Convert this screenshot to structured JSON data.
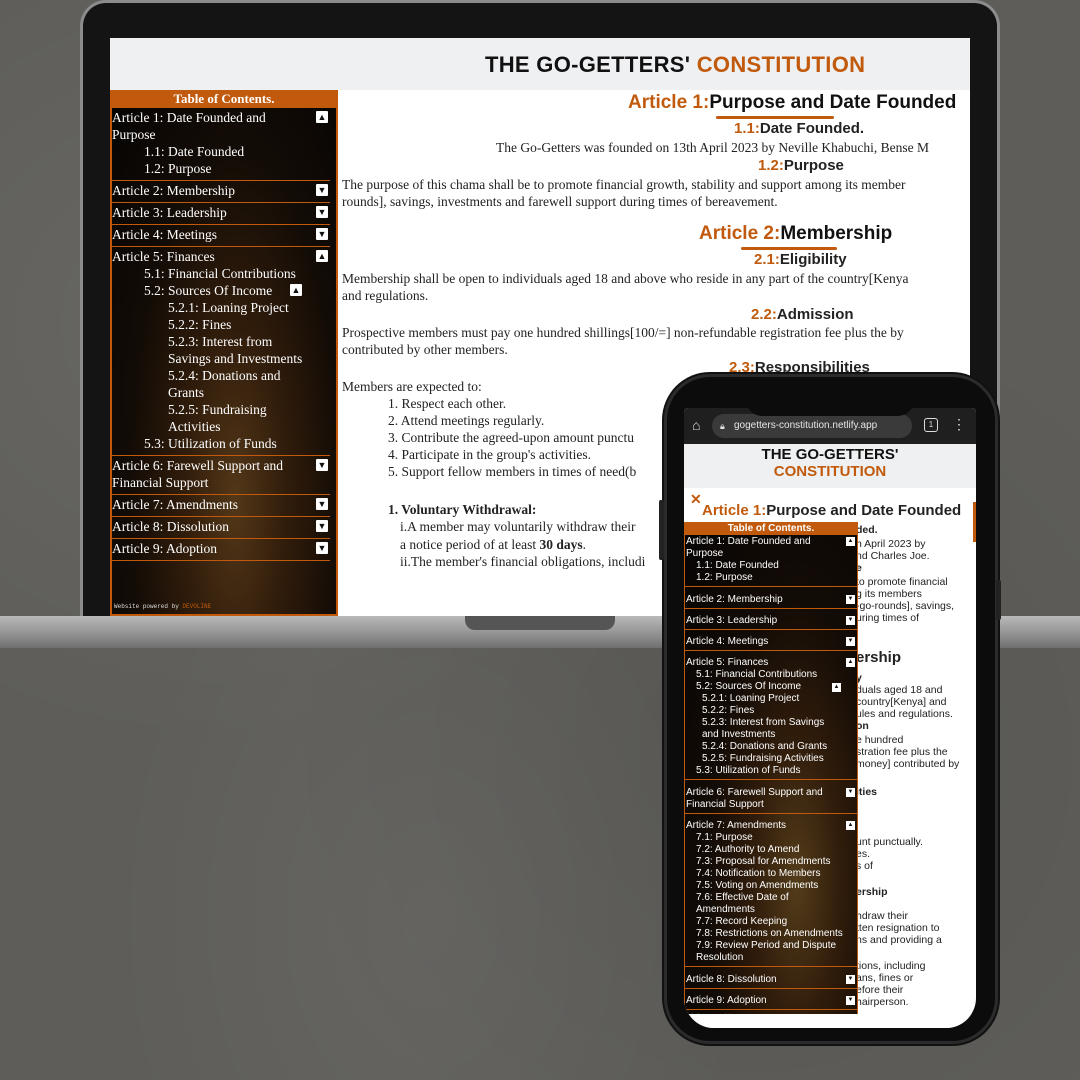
{
  "site": {
    "title_black": "THE GO-GETTERS'",
    "title_orange": "CONSTITUTION",
    "toc_heading": "Table of Contents.",
    "footer_prefix": "Website powered by",
    "footer_brand": "DEVOLINE"
  },
  "desktop": {
    "toc": [
      {
        "label": "Article 1: Date Founded and Purpose",
        "toggle": "▲",
        "subs": [
          {
            "label": "1.1: Date Founded"
          },
          {
            "label": "1.2: Purpose"
          }
        ]
      },
      {
        "label": "Article 2: Membership",
        "toggle": "▼"
      },
      {
        "label": "Article 3: Leadership",
        "toggle": "▼"
      },
      {
        "label": "Article 4: Meetings",
        "toggle": "▼"
      },
      {
        "label": "Article 5: Finances",
        "toggle": "▲"
      },
      {
        "label": "Article 6: Farewell Support and Financial Support",
        "toggle": "▼"
      },
      {
        "label": "Article 7: Amendments",
        "toggle": "▼"
      },
      {
        "label": "Article 8: Dissolution",
        "toggle": "▼"
      },
      {
        "label": "Article 9: Adoption",
        "toggle": "▼"
      }
    ],
    "finances_subs": {
      "s51": "5.1: Financial Contributions",
      "s52": "5.2: Sources Of Income",
      "s52_toggle": "▲",
      "s521": "5.2.1: Loaning Project",
      "s522": "5.2.2: Fines",
      "s523": "5.2.3: Interest from Savings and Investments",
      "s524": "5.2.4: Donations and Grants",
      "s525": "5.2.5: Fundraising Activities",
      "s53": "5.3: Utilization of Funds"
    },
    "content": {
      "a1_num": "Article 1:",
      "a1_title": "Purpose and Date Founded",
      "s11_num": "1.1:",
      "s11_title": "Date Founded.",
      "s11_text": "The Go-Getters was founded on 13th April 2023 by Neville Khabuchi, Bense M",
      "s12_num": "1.2:",
      "s12_title": "Purpose",
      "s12_text1": "The purpose of this chama shall be to promote financial growth, stability and support among its member",
      "s12_text2": "rounds], savings, investments and farewell support during times of bereavement.",
      "a2_num": "Article 2:",
      "a2_title": "Membership",
      "s21_num": "2.1:",
      "s21_title": "Eligibility",
      "s21_text1": "Membership shall be open to individuals aged 18 and above who reside in any part of the country[Kenya",
      "s21_text2": "and regulations.",
      "s22_num": "2.2:",
      "s22_title": "Admission",
      "s22_text1": "Prospective members must pay one hundred shillings[100/=] non-refundable registration fee plus the by",
      "s22_text2": "contributed by other members.",
      "s23_num": "2.3:",
      "s23_title": "Responsibilities",
      "expect": "Members are expected to:",
      "duties": [
        "1. Respect each other.",
        "2. Attend meetings regularly.",
        "3. Contribute the agreed-upon amount punctu",
        "4. Participate in the group's activities.",
        "5. Support fellow members in times of need(b"
      ],
      "vw_label": "1. Voluntary Withdrawal:",
      "vw_i_a": "i.A member may voluntarily withdraw their",
      "vw_i_b": "a notice period of at least",
      "vw_i_days": "30 days",
      "vw_i_c": ".",
      "vw_ii": "ii.The member's financial obligations, includi"
    }
  },
  "mobile": {
    "url": "gogetters-constitution.netlify.app",
    "tab_count": "1",
    "close": "✕",
    "header_l1": "THE GO-GETTERS'",
    "header_l2": "CONSTITUTION",
    "a1_num": "Article 1:",
    "a1_title": "Purpose and Date Founded",
    "fragments": [
      "ded.",
      "h April 2023 by",
      "nd Charles Joe.",
      "e",
      "to promote financial",
      "g its members",
      "-go-rounds], savings,",
      "uring times of",
      "ership",
      "y",
      "duals aged 18 and",
      "country[Kenya] and",
      "ules and regulations.",
      "on",
      "e hundred",
      "stration fee plus the",
      "money] contributed by",
      "ities",
      "unt punctually.",
      "es.",
      "s of",
      "ership",
      "hdraw their",
      "tten resignation to",
      "ns and providing a",
      "tions, including",
      "ans, fines or",
      "efore their",
      "hairperson."
    ],
    "toc": {
      "a1": "Article 1: Date Founded and Purpose",
      "a1_subs": [
        "1.1: Date Founded",
        "1.2: Purpose"
      ],
      "a2": "Article 2: Membership",
      "a3": "Article 3: Leadership",
      "a4": "Article 4: Meetings",
      "a5": "Article 5: Finances",
      "a5_subs": [
        "5.1: Financial Contributions",
        "5.2: Sources Of Income"
      ],
      "a5_subsubs": [
        "5.2.1: Loaning Project",
        "5.2.2: Fines",
        "5.2.3: Interest from Savings and Investments",
        "5.2.4: Donations and Grants",
        "5.2.5: Fundraising Activities"
      ],
      "a5_last": "5.3: Utilization of Funds",
      "a6": "Article 6: Farewell Support and Financial Support",
      "a7": "Article 7: Amendments",
      "a7_subs": [
        "7.1: Purpose",
        "7.2: Authority to Amend",
        "7.3: Proposal for Amendments",
        "7.4: Notification to Members",
        "7.5: Voting on Amendments",
        "7.6: Effective Date of Amendments",
        "7.7: Record Keeping",
        "7.8: Restrictions on Amendments",
        "7.9: Review Period and Dispute Resolution"
      ],
      "a8": "Article 8: Dissolution",
      "a9": "Article 9: Adoption",
      "up": "▲",
      "down": "▼"
    }
  },
  "colors": {
    "accent": "#c15a0c",
    "backdrop": "#5e5d59"
  }
}
